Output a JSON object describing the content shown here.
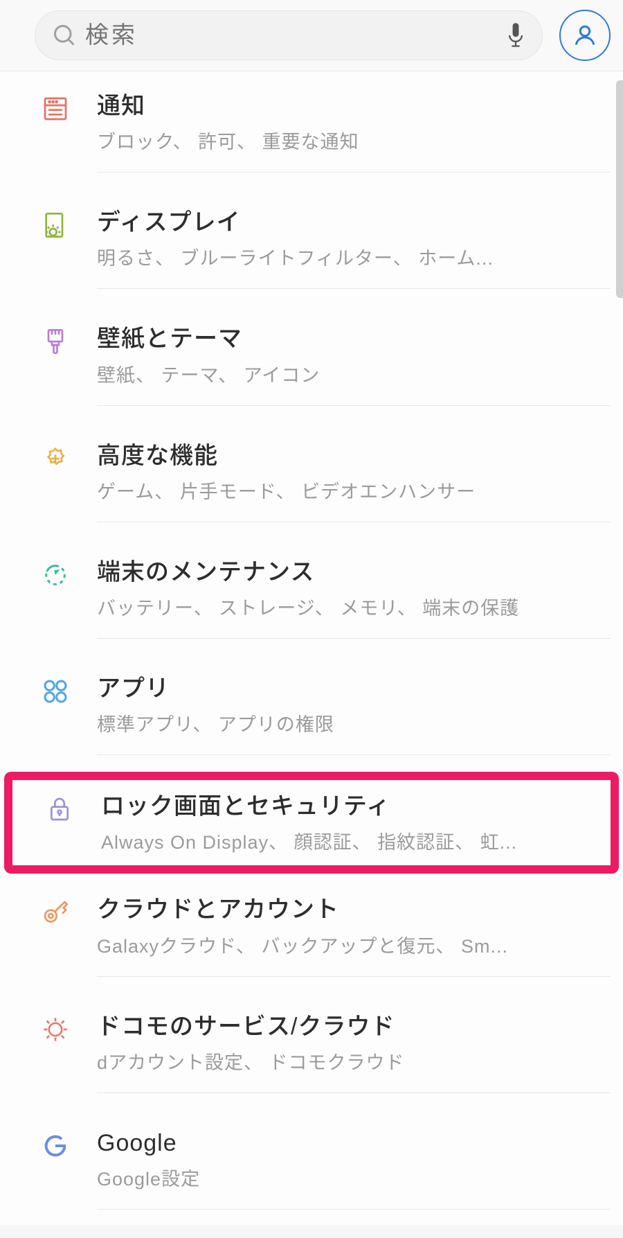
{
  "search": {
    "placeholder": "検索"
  },
  "items": [
    {
      "id": "notifications",
      "title": "通知",
      "subtitle": "ブロック、 許可、 重要な通知"
    },
    {
      "id": "display",
      "title": "ディスプレイ",
      "subtitle": "明るさ、 ブルーライトフィルター、 ホーム..."
    },
    {
      "id": "wallpaper",
      "title": "壁紙とテーマ",
      "subtitle": "壁紙、 テーマ、 アイコン"
    },
    {
      "id": "advanced",
      "title": "高度な機能",
      "subtitle": "ゲーム、 片手モード、 ビデオエンハンサー"
    },
    {
      "id": "maintenance",
      "title": "端末のメンテナンス",
      "subtitle": "バッテリー、 ストレージ、 メモリ、 端末の保護"
    },
    {
      "id": "apps",
      "title": "アプリ",
      "subtitle": "標準アプリ、 アプリの権限"
    },
    {
      "id": "lockscreen",
      "title": "ロック画面とセキュリティ",
      "subtitle": "Always On Display、 顔認証、 指紋認証、 虹..."
    },
    {
      "id": "cloud",
      "title": "クラウドとアカウント",
      "subtitle": "Galaxyクラウド、 バックアップと復元、 Sm..."
    },
    {
      "id": "docomo",
      "title": "ドコモのサービス/クラウド",
      "subtitle": "dアカウント設定、 ドコモクラウド"
    },
    {
      "id": "google",
      "title": "Google",
      "subtitle": "Google設定"
    }
  ],
  "highlighted_id": "lockscreen"
}
